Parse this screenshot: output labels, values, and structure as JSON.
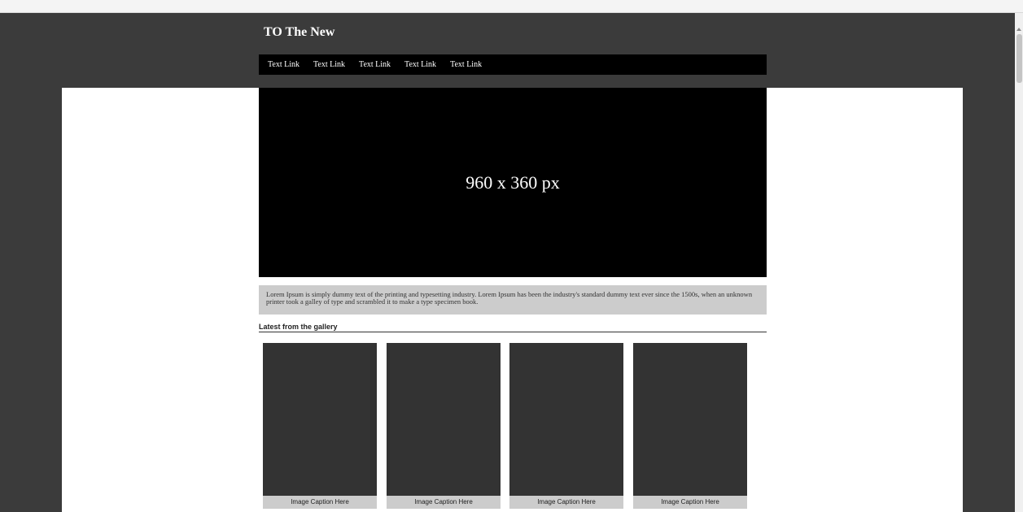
{
  "site": {
    "title": "TO The New"
  },
  "nav": {
    "links": [
      "Text Link",
      "Text Link",
      "Text Link",
      "Text Link",
      "Text Link"
    ]
  },
  "hero": {
    "placeholder": "960 x 360 px"
  },
  "intro": {
    "text": "Lorem Ipsum is simply dummy text of the printing and typesetting industry. Lorem Ipsum has been the industry's standard dummy text ever since the 1500s, when an unknown printer took a galley of type and scrambled it to make a type specimen book."
  },
  "gallery": {
    "heading": "Latest from the gallery",
    "items": [
      {
        "caption": "Image Caption Here"
      },
      {
        "caption": "Image Caption Here"
      },
      {
        "caption": "Image Caption Here"
      },
      {
        "caption": "Image Caption Here"
      }
    ]
  },
  "colors": {
    "header_bg": "#3b3b3b",
    "nav_bg": "#000000",
    "hero_bg": "#000000",
    "intro_bg": "#cccccc",
    "gallery_image_bg": "#333333",
    "caption_bg": "#cccccc"
  }
}
